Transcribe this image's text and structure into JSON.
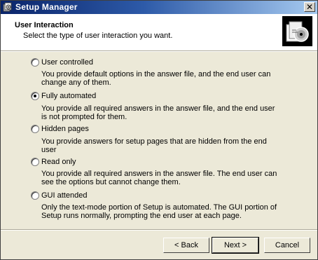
{
  "window": {
    "title": "Setup Manager",
    "close_glyph": "✕"
  },
  "header": {
    "title": "User Interaction",
    "subtitle": "Select the type of user interaction you want.",
    "icon": "setup-manager-wizard-icon"
  },
  "options": [
    {
      "label": "User controlled",
      "description": "You provide default options in the answer file, and the end user can change any of them.",
      "checked": false
    },
    {
      "label": "Fully automated",
      "description": "You provide all required answers in the answer file, and the end user is not prompted for them.",
      "checked": true
    },
    {
      "label": "Hidden pages",
      "description": "You provide answers for setup pages that are hidden from the end user",
      "checked": false
    },
    {
      "label": "Read only",
      "description": "You provide all required answers in the answer file. The end user can see the options but cannot change them.",
      "checked": false
    },
    {
      "label": "GUI attended",
      "description": "Only the text-mode portion of Setup is automated. The GUI portion of Setup runs normally, prompting the end user at each page.",
      "checked": false
    }
  ],
  "buttons": {
    "back": "< Back",
    "next": "Next >",
    "cancel": "Cancel"
  },
  "colors": {
    "titlebar_start": "#0a246a",
    "titlebar_end": "#a6caf0",
    "face": "#ece9d8"
  }
}
